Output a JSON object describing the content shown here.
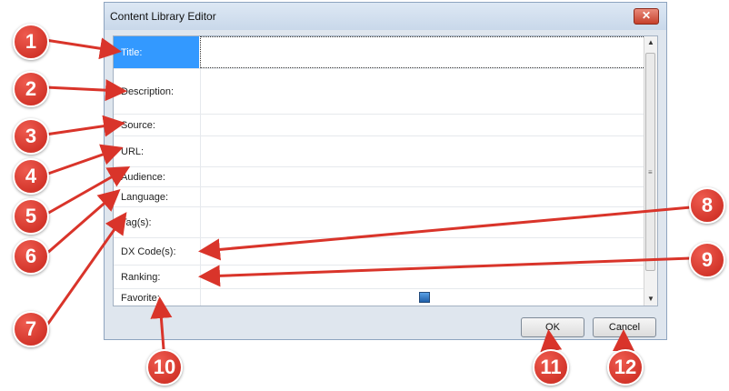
{
  "window": {
    "title": "Content Library Editor",
    "close_glyph": "✕"
  },
  "fields": [
    {
      "label": "Title:"
    },
    {
      "label": "Description:"
    },
    {
      "label": "Source:"
    },
    {
      "label": "URL:"
    },
    {
      "label": "Audience:"
    },
    {
      "label": "Language:"
    },
    {
      "label": "Tag(s):"
    },
    {
      "label": "DX Code(s):"
    },
    {
      "label": "Ranking:"
    },
    {
      "label": "Favorite:"
    }
  ],
  "buttons": {
    "ok": "OK",
    "cancel": "Cancel"
  },
  "callouts": [
    "1",
    "2",
    "3",
    "4",
    "5",
    "6",
    "7",
    "8",
    "9",
    "10",
    "11",
    "12"
  ],
  "colors": {
    "callout": "#d9342a",
    "selection": "#3399ff"
  },
  "icons": {
    "scroll_up": "▲",
    "scroll_down": "▼",
    "scroll_grip": "≡"
  }
}
